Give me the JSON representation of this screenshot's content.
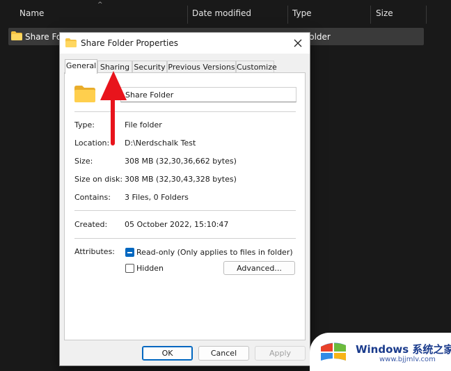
{
  "explorer": {
    "columns": {
      "name": "Name",
      "date_modified": "Date modified",
      "type": "Type",
      "size": "Size"
    },
    "row": {
      "name": "Share Folder",
      "type": "folder"
    }
  },
  "dialog": {
    "title": "Share Folder Properties",
    "tabs": [
      "General",
      "Sharing",
      "Security",
      "Previous Versions",
      "Customize"
    ],
    "active_tab": "General",
    "name_value": "Share Folder",
    "properties": {
      "type_label": "Type:",
      "type_value": "File folder",
      "location_label": "Location:",
      "location_value": "D:\\Nerdschalk Test",
      "size_label": "Size:",
      "size_value": "308 MB (32,30,36,662 bytes)",
      "size_on_disk_label": "Size on disk:",
      "size_on_disk_value": "308 MB (32,30,43,328 bytes)",
      "contains_label": "Contains:",
      "contains_value": "3 Files, 0 Folders",
      "created_label": "Created:",
      "created_value": "05 October 2022, 15:10:47",
      "attributes_label": "Attributes:"
    },
    "attributes": {
      "readonly_label": "Read-only (Only applies to files in folder)",
      "readonly_state": "indeterminate",
      "hidden_label": "Hidden",
      "hidden_state": "unchecked",
      "advanced_label": "Advanced..."
    },
    "buttons": {
      "ok": "OK",
      "cancel": "Cancel",
      "apply": "Apply"
    }
  },
  "watermark": {
    "title": "Windows 系统之家",
    "url": "www.bjjmlv.com"
  },
  "colors": {
    "accent": "#0067c0",
    "annotation_arrow": "#e8141c",
    "folder": "#f5c242"
  }
}
